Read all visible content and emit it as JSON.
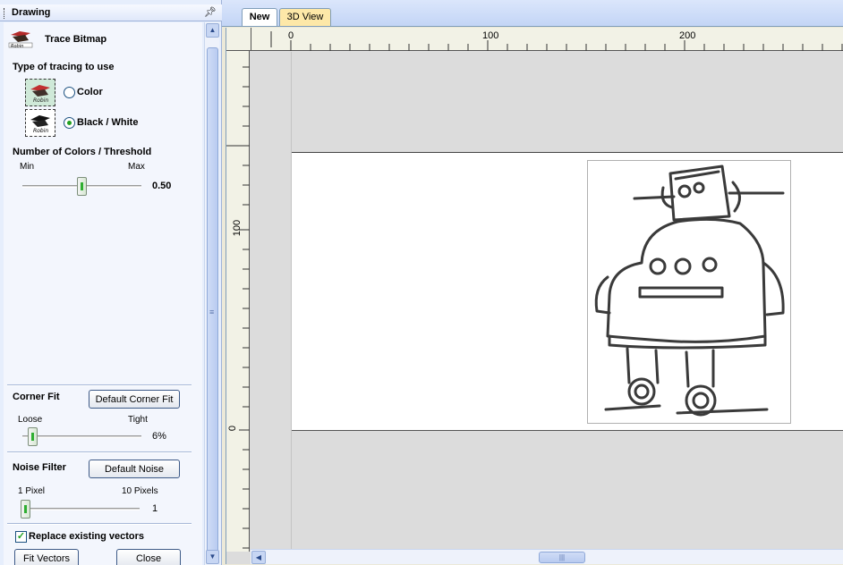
{
  "panel": {
    "title": "Drawing",
    "tool_title": "Trace Bitmap",
    "tracing_type_label": "Type of tracing to use",
    "tracing_options": [
      {
        "label": "Color",
        "selected": false
      },
      {
        "label": "Black / White",
        "selected": true
      }
    ],
    "threshold": {
      "label": "Number of Colors / Threshold",
      "min_label": "Min",
      "max_label": "Max",
      "value_text": "0.50",
      "value": 0.5
    },
    "corner_fit": {
      "label": "Corner Fit",
      "button": "Default Corner Fit",
      "min_label": "Loose",
      "max_label": "Tight",
      "value_text": "6%",
      "value": 0.06
    },
    "noise_filter": {
      "label": "Noise Filter",
      "button": "Default Noise",
      "min_label": "1 Pixel",
      "max_label": "10 Pixels",
      "value_text": "1",
      "value": 1
    },
    "replace_vectors": {
      "label": "Replace existing vectors",
      "checked": true
    },
    "fit_button": "Fit Vectors",
    "close_button": "Close"
  },
  "tabs": [
    {
      "label": "New",
      "active": true
    },
    {
      "label": "3D View",
      "active": false
    }
  ],
  "ruler": {
    "h_labels": [
      "0",
      "100",
      "200"
    ],
    "v_labels": [
      "100",
      "0"
    ]
  },
  "colors": {
    "panel_bg": "#f3f6fd",
    "accent": "#21a121",
    "tab_3d_bg": "#fde8a8"
  }
}
